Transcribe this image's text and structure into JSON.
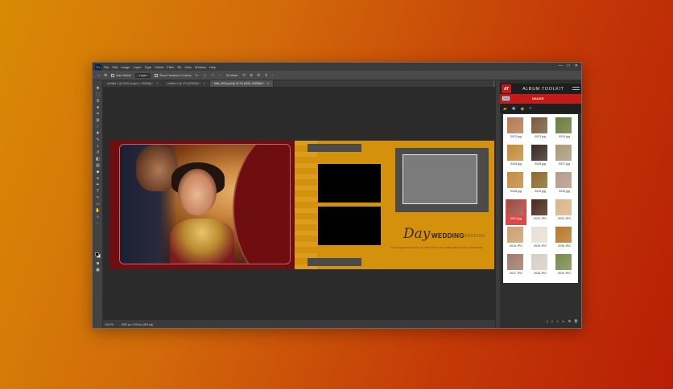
{
  "app": {
    "logo": "Ps",
    "menu": [
      "File",
      "Edit",
      "Image",
      "Layer",
      "Type",
      "Select",
      "Filter",
      "3D",
      "View",
      "Window",
      "Help"
    ],
    "window_controls": [
      "—",
      "□",
      "✕"
    ]
  },
  "options_bar": {
    "auto_select_label": "Auto-Select:",
    "layer_value": "Layer",
    "show_transform_label": "Show Transform Controls",
    "mode_label": "3D Mode:"
  },
  "tabs": [
    {
      "label": "Untitled-1 @ 300% (Layer 1, RGB/8#) *",
      "active": false
    },
    {
      "label": "Untitled-2 @ 17% (RGB/8) *",
      "active": false
    },
    {
      "label": "Side_0013.psd @ 16.7% (0021, RGB/8#) *",
      "active": true
    }
  ],
  "canvas": {
    "script_title": "Day",
    "main_title": "WEDDING",
    "sub_title": "WEDDING",
    "body_text": "We are together as one in love, we shall be forever more, wedding day memories to cherish always",
    "colors": {
      "left_page": "#6e0e10",
      "right_page": "#d4920c",
      "frames": "#4b4b4b"
    }
  },
  "statusbar": {
    "zoom": "16.67%",
    "doc_info": "3000 px x 1000 px (300 ppi)"
  },
  "panel": {
    "badge": "AT",
    "title": "ALBUM TOOLKIT",
    "image_label": "IMAGE",
    "toolbar_icons": [
      "folder-icon",
      "settings-icon",
      "layers-icon",
      "search-icon"
    ],
    "thumbnails": [
      {
        "name": "0022.jpg",
        "color": "#b47a54"
      },
      {
        "name": "0023.jpg",
        "color": "#7a5a3c"
      },
      {
        "name": "0024.jpg",
        "color": "#6a7a3c"
      },
      {
        "name": "0025.jpg",
        "color": "#c28c3a"
      },
      {
        "name": "0026.jpg",
        "color": "#3a2a24"
      },
      {
        "name": "0027.jpg",
        "color": "#a89a7a"
      },
      {
        "name": "0028.jpg",
        "color": "#c48a40"
      },
      {
        "name": "0029.jpg",
        "color": "#8a6a2a"
      },
      {
        "name": "0030.jpg",
        "color": "#b59a88"
      },
      {
        "name": "0031.jpg",
        "color": "#9c4a3c",
        "selected": true
      },
      {
        "name": "0032.JPG",
        "color": "#4a2a1c"
      },
      {
        "name": "0033.JPG",
        "color": "#d9b58a"
      },
      {
        "name": "0034.JPG",
        "color": "#caa070"
      },
      {
        "name": "0035.JPG",
        "color": "#e8e0d4"
      },
      {
        "name": "0036.JPG",
        "color": "#b8782c"
      },
      {
        "name": "0037.JPG",
        "color": "#a07a6a"
      },
      {
        "name": "0038.JPG",
        "color": "#d6cfc4"
      },
      {
        "name": "0039.JPG",
        "color": "#7a8a4a"
      }
    ]
  }
}
